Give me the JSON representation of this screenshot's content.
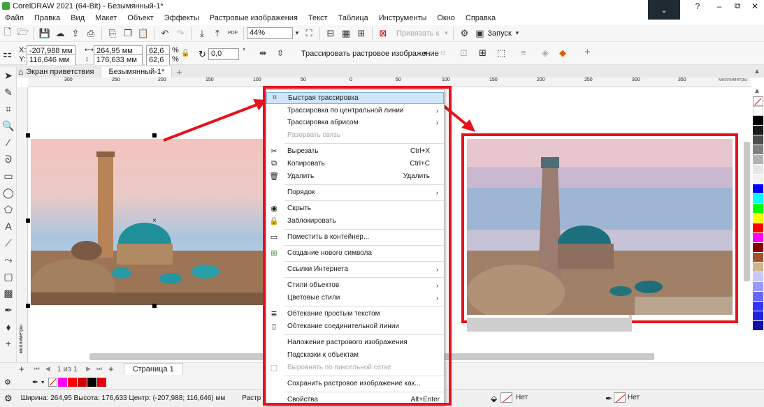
{
  "window": {
    "title": "CorelDRAW 2021 (64-Bit) - Безымянный-1*",
    "controls": {
      "help": "?",
      "minimize": "–",
      "restore": "⧉",
      "close": "✕"
    }
  },
  "menu": [
    "Файл",
    "Правка",
    "Вид",
    "Макет",
    "Объект",
    "Эффекты",
    "Растровые изображения",
    "Текст",
    "Таблица",
    "Инструменты",
    "Окно",
    "Справка"
  ],
  "toolbar": {
    "zoom": "44%",
    "snap": "Привязать к",
    "launch": "Запуск",
    "pdf": "PDF"
  },
  "propbar": {
    "x": "-207,988 мм",
    "y": "116,646 мм",
    "w": "264,95 мм",
    "h": "176,633 мм",
    "sx": "62,6",
    "sy": "62,6",
    "pct": "%",
    "angle": "0,0",
    "deg": "°",
    "trace": "Трассировать растровое изображение",
    "x_lbl": "X:",
    "y_lbl": "Y:"
  },
  "tabs": {
    "welcome": "Экран приветствия",
    "doc": "Безымянный-1*",
    "add": "+"
  },
  "ruler": {
    "ticks": [
      "300",
      "250",
      "200",
      "150",
      "100",
      "50",
      "0",
      "50",
      "100",
      "150",
      "200",
      "250",
      "300",
      "350"
    ],
    "unit": "миллиметры",
    "vunit": "миллиметры"
  },
  "context_menu": [
    {
      "label": "Быстрая трассировка",
      "icon": "⌗"
    },
    {
      "label": "Трассировка по центральной линии",
      "arrow": "›"
    },
    {
      "label": "Трассировка абрисом",
      "arrow": "›"
    },
    {
      "label": "Разорвать связь",
      "disabled": true
    },
    {
      "label": "Вырезать",
      "icon": "✂",
      "shortcut": "Ctrl+X"
    },
    {
      "label": "Копировать",
      "icon": "⧉",
      "shortcut": "Ctrl+C"
    },
    {
      "label": "Удалить",
      "icon": "🗑",
      "shortcut": "Удалить"
    },
    {
      "label": "Порядок",
      "arrow": "›"
    },
    {
      "label": "Скрыть",
      "icon": "◉"
    },
    {
      "label": "Заблокировать",
      "icon": "🔒"
    },
    {
      "label": "Поместить в контейнер...",
      "icon": "▭"
    },
    {
      "label": "Создание нового символа",
      "icon": "⊞"
    },
    {
      "label": "Ссылки Интернета",
      "arrow": "›"
    },
    {
      "label": "Стили объектов",
      "arrow": "›"
    },
    {
      "label": "Цветовые стили",
      "arrow": "›"
    },
    {
      "label": "Обтекание простым текстом",
      "icon": "≣"
    },
    {
      "label": "Обтекание соединительной линии",
      "icon": "▯"
    },
    {
      "label": "Наложение растрового изображения"
    },
    {
      "label": "Подсказки к объектам"
    },
    {
      "label": "Выровнять по пиксельной сетке",
      "disabled": true,
      "icon": "▢"
    },
    {
      "label": "Сохранить растровое изображение как..."
    },
    {
      "label": "Свойства",
      "shortcut": "Alt+Enter"
    }
  ],
  "pager": {
    "first": "⏮",
    "prev": "◀",
    "current": "1",
    "sep": "из",
    "total": "1",
    "next": "▶",
    "last": "⏭",
    "add": "+",
    "page_tab": "Страница 1"
  },
  "status": {
    "size": "Ширина: 264,95 Высота: 176,633 Центр: (-207,988; 116,646)  мм",
    "mode": "Растр (RGB)",
    "fill": "Нет",
    "outline": "Нет"
  },
  "colors": {
    "annotation_red": "#e8111b",
    "palette": [
      "#ffffff",
      "#000000",
      "#1a1a1a",
      "#4d4d4d",
      "#808080",
      "#b3b3b3",
      "#e6e6e6",
      "#f2f2f2",
      "#0000ff",
      "#00ffff",
      "#00ff00",
      "#ffff00",
      "#ff0000",
      "#ff00ff",
      "#8b0000",
      "#a0522d",
      "#d2b48c",
      "#c8c8ff",
      "#9999ff",
      "#6666ff",
      "#3333ff",
      "#2222dd",
      "#1111aa"
    ],
    "doc_palette": [
      "#ff00ff",
      "#ff0000",
      "#cc0000",
      "#000000",
      "#e10010"
    ]
  }
}
